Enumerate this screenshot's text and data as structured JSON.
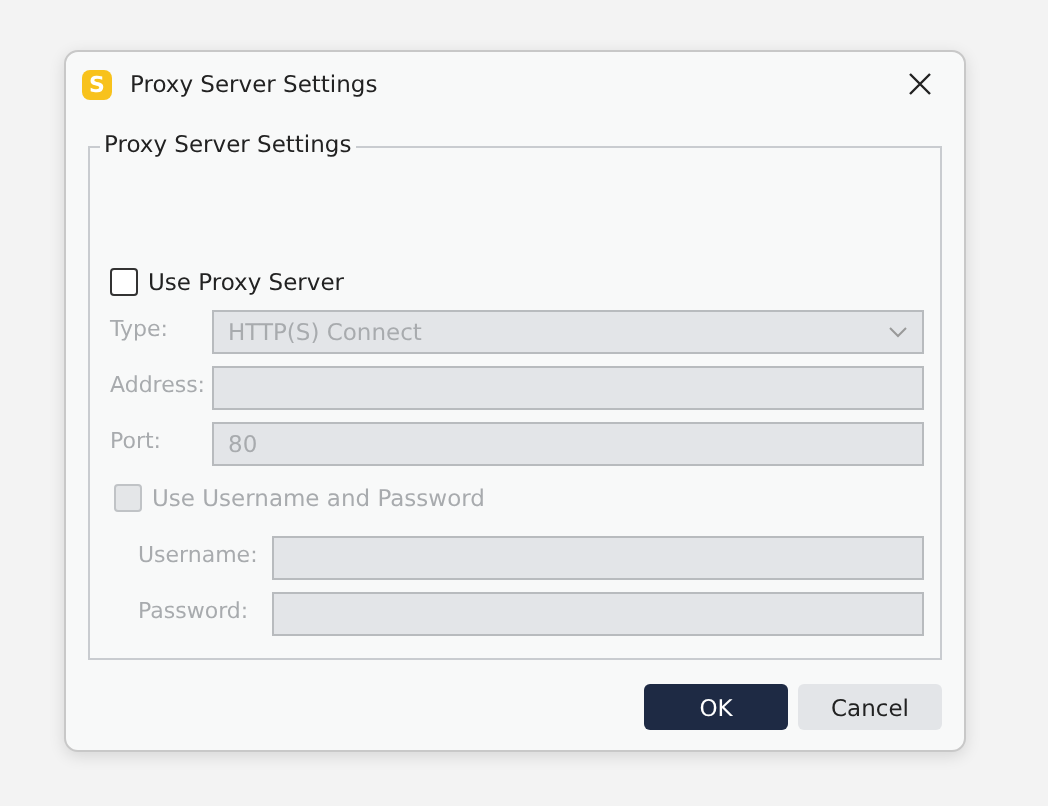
{
  "window": {
    "title": "Proxy Server Settings",
    "app_icon": "S"
  },
  "group": {
    "title": "Proxy Server Settings"
  },
  "use_proxy": {
    "label": "Use Proxy Server",
    "checked": false,
    "disabled": false
  },
  "fields": [
    {
      "label": "Type:",
      "kind": "dropdown",
      "value": "HTTP(S) Connect",
      "disabled": true
    },
    {
      "label": "Address:",
      "kind": "text",
      "disabled": true
    },
    {
      "label": "Port:",
      "kind": "text",
      "value": "80",
      "disabled": true
    }
  ],
  "use_auth": {
    "label": "Use Username and Password",
    "checked": false,
    "disabled": true
  },
  "auth_fields": [
    {
      "label": "Username:",
      "kind": "text",
      "disabled": true
    },
    {
      "label": "Password:",
      "kind": "text",
      "disabled": true
    }
  ],
  "buttons": [
    {
      "label": "OK",
      "kind": "primary"
    },
    {
      "label": "Cancel",
      "kind": "secondary"
    }
  ]
}
